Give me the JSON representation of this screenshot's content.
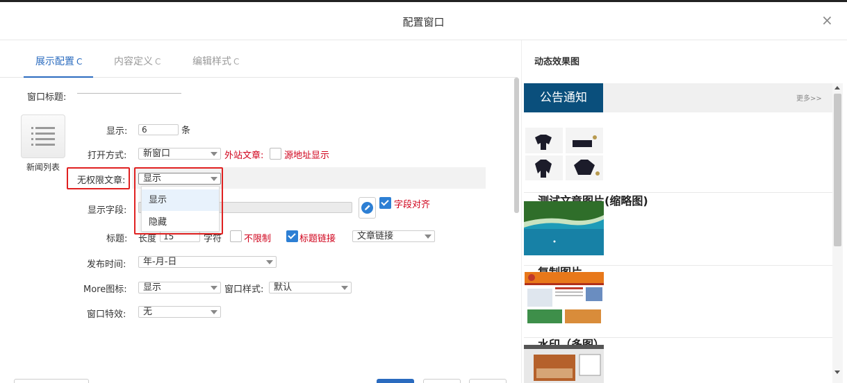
{
  "dialog": {
    "title": "配置窗口",
    "close": "×"
  },
  "tabs": [
    {
      "label": "展示配置",
      "refresh": "C"
    },
    {
      "label": "内容定义",
      "refresh": "C"
    },
    {
      "label": "编辑样式",
      "refresh": "C"
    }
  ],
  "form": {
    "window_title_label": "窗口标题:",
    "widget_caption": "新闻列表",
    "display_label": "显示:",
    "display_count": "6",
    "display_unit": "条",
    "open_mode_label": "打开方式:",
    "open_mode_value": "新窗口",
    "external_label": "外站文章:",
    "source_label": "源地址显示",
    "unlimited_label": "无权限文章:",
    "unlimited_value": "显示",
    "fields_label": "显示字段:",
    "field_align_label": "字段对齐",
    "title_label": "标题:",
    "length_label": "长度",
    "length_value": "15",
    "chars_label": "字符",
    "unlimited_chk_label": "不限制",
    "title_link_label": "标题链接",
    "link_type_value": "文章链接",
    "date_label": "发布时间:",
    "date_value": "年-月-日",
    "more_label": "More图标:",
    "more_value": "显示",
    "style_label": "窗口样式:",
    "style_value": "默认",
    "effect_label": "窗口特效:",
    "effect_value": "无"
  },
  "dropdown": {
    "options": [
      "显示",
      "隐藏"
    ]
  },
  "preview": {
    "title": "动态效果图",
    "tab": "公告通知",
    "more": "更多>>",
    "articles": [
      "测试文章图片(缩略图)",
      "复制图片",
      "水印（多图）"
    ]
  },
  "colors": {
    "accent": "#2a6bbf",
    "red": "#d0021b",
    "tab_bg": "#0a4f7c"
  }
}
